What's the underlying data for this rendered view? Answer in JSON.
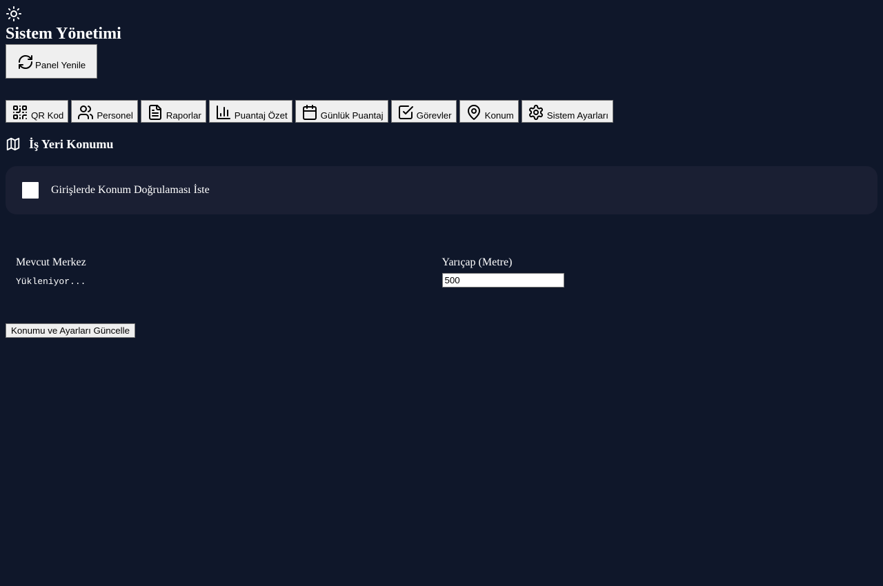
{
  "header": {
    "theme_icon": "sun-icon",
    "title": "Sistem Yönetimi",
    "refresh_label": "Panel Yenile",
    "refresh_icon": "refresh-icon"
  },
  "nav": {
    "items": [
      {
        "label": "QR Kod",
        "icon": "qr-code-icon"
      },
      {
        "label": "Personel",
        "icon": "users-icon"
      },
      {
        "label": "Raporlar",
        "icon": "file-text-icon"
      },
      {
        "label": "Puantaj Özet",
        "icon": "bar-chart-icon"
      },
      {
        "label": "Günlük Puantaj",
        "icon": "calendar-icon"
      },
      {
        "label": "Görevler",
        "icon": "check-square-icon"
      },
      {
        "label": "Konum",
        "icon": "map-pin-icon"
      },
      {
        "label": "Sistem Ayarları",
        "icon": "settings-icon"
      }
    ]
  },
  "section": {
    "icon": "map-icon",
    "title": "İş Yeri Konumu"
  },
  "verification": {
    "label": "Girişlerde Konum Doğrulaması İste",
    "checked": false
  },
  "fields": {
    "center_label": "Mevcut Merkez",
    "center_value": "Yükleniyor...",
    "radius_label": "Yarıçap (Metre)",
    "radius_value": "500"
  },
  "actions": {
    "update_label": "Konumu ve Ayarları Güncelle"
  }
}
